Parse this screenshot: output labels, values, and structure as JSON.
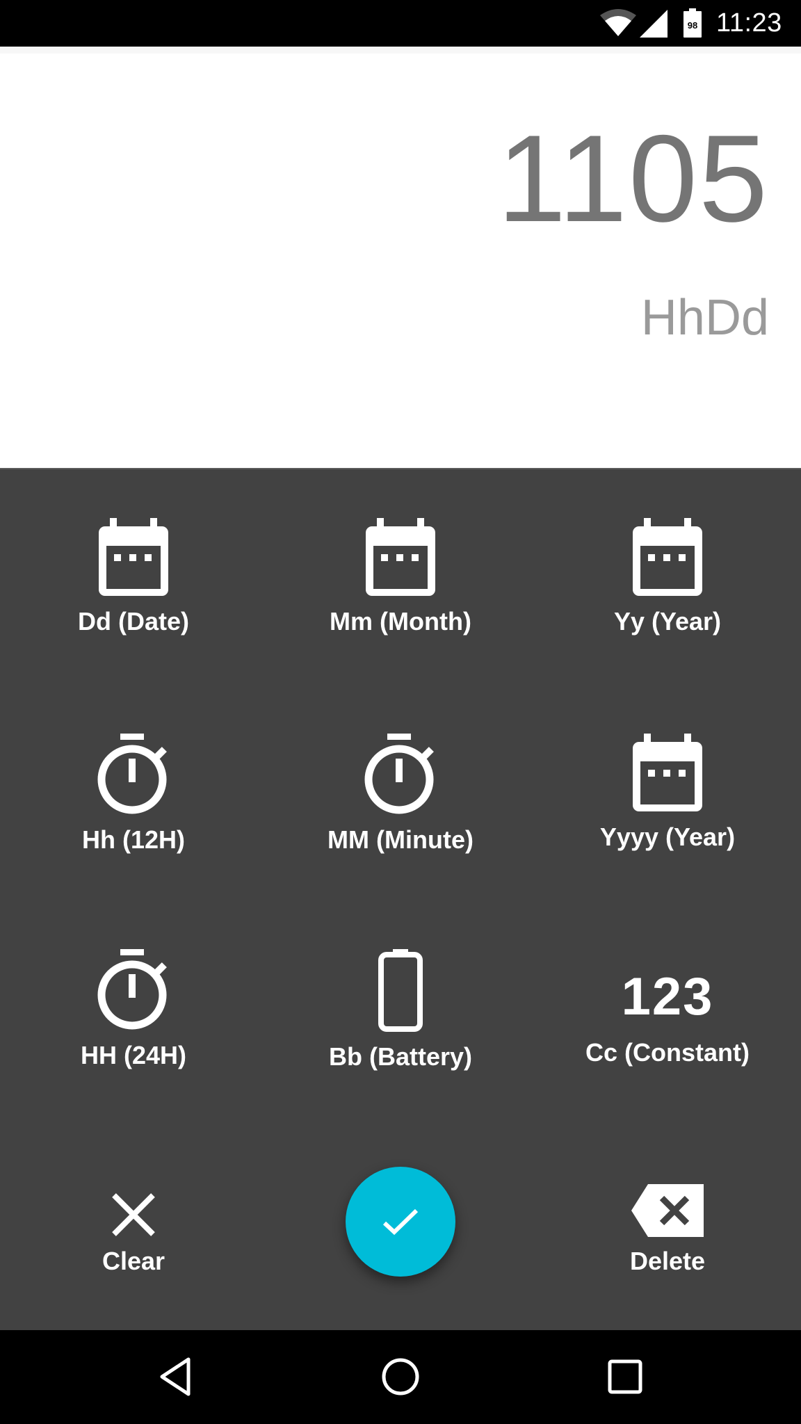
{
  "status_bar": {
    "time": "11:23",
    "battery_level": "98",
    "icons": [
      "wifi-icon",
      "cell-signal-icon",
      "battery-icon"
    ]
  },
  "display": {
    "value": "1105",
    "format": "HhDd"
  },
  "keys": [
    {
      "label": "Dd (Date)",
      "icon": "calendar-icon"
    },
    {
      "label": "Mm (Month)",
      "icon": "calendar-icon"
    },
    {
      "label": "Yy (Year)",
      "icon": "calendar-icon"
    },
    {
      "label": "Hh (12H)",
      "icon": "timer-icon"
    },
    {
      "label": "MM (Minute)",
      "icon": "timer-icon"
    },
    {
      "label": "Yyyy (Year)",
      "icon": "calendar-icon"
    },
    {
      "label": "HH (24H)",
      "icon": "timer-icon"
    },
    {
      "label": "Bb (Battery)",
      "icon": "battery-outline-icon"
    },
    {
      "label": "Cc (Constant)",
      "icon": "numeric-123-icon",
      "glyph": "123"
    }
  ],
  "actions": {
    "clear_label": "Clear",
    "delete_label": "Delete",
    "confirm_icon": "check-icon"
  },
  "colors": {
    "accent": "#00bcd8",
    "keypad_bg": "#424242",
    "display_bg": "#ffffff",
    "value_text": "#757575",
    "format_text": "#9a9a9a"
  },
  "nav_bar": {
    "buttons": [
      "back-icon",
      "home-icon",
      "recents-icon"
    ]
  }
}
